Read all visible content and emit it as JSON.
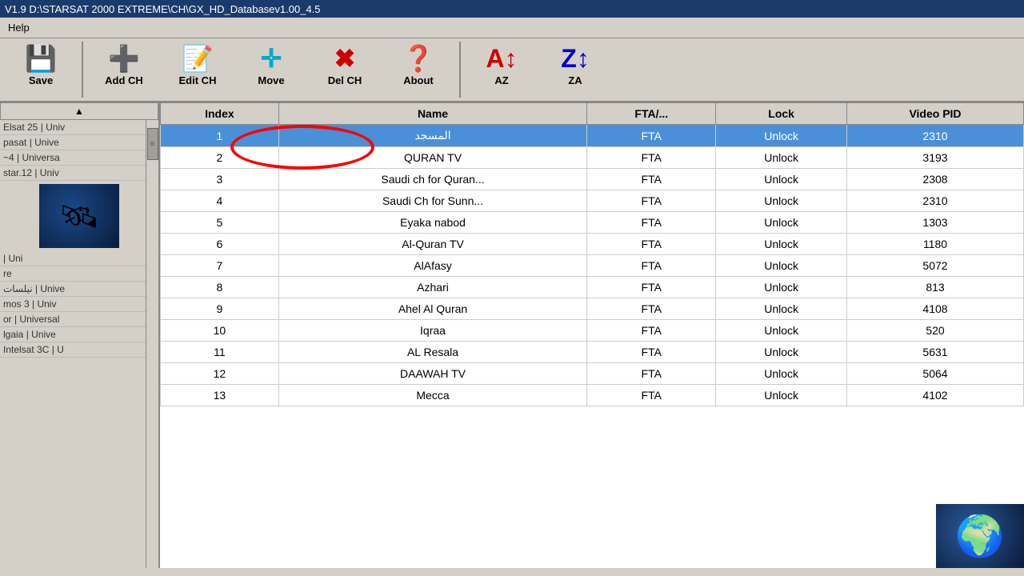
{
  "titleBar": {
    "text": "V1.9 D:\\STARSAT 2000 EXTREME\\CH\\GX_HD_Databasev1.00_4.5"
  },
  "menuBar": {
    "items": [
      "Help"
    ]
  },
  "toolbar": {
    "buttons": [
      {
        "id": "save",
        "label": "Save",
        "icon": "💾",
        "iconClass": "icon-save"
      },
      {
        "id": "add-ch",
        "label": "Add CH",
        "icon": "➕",
        "iconClass": "icon-add"
      },
      {
        "id": "edit-ch",
        "label": "Edit CH",
        "icon": "📝",
        "iconClass": "icon-edit"
      },
      {
        "id": "move",
        "label": "Move",
        "icon": "✛",
        "iconClass": "icon-move"
      },
      {
        "id": "del-ch",
        "label": "Del CH",
        "icon": "✖",
        "iconClass": "icon-del"
      },
      {
        "id": "about",
        "label": "About",
        "icon": "❓",
        "iconClass": "icon-about"
      },
      {
        "id": "az",
        "label": "AZ",
        "icon": "A↕",
        "iconClass": "icon-az"
      },
      {
        "id": "za",
        "label": "ZA",
        "icon": "Z↕",
        "iconClass": "icon-za"
      }
    ]
  },
  "sidebar": {
    "items": [
      "Elsat 25 | Univ",
      "pasat | Unive",
      "~4 | Universa",
      "star.12 | Univ",
      "| Uni",
      "re",
      "نيلسات | Unive",
      "mos 3 | Univ",
      "or | Universal",
      "lgaia | Unive",
      "Intelsat 3C | U"
    ]
  },
  "table": {
    "columns": [
      "Index",
      "Name",
      "FTA/...",
      "Lock",
      "Video PID"
    ],
    "rows": [
      {
        "index": 1,
        "name": "المسجد",
        "fta": "FTA",
        "lock": "Unlock",
        "videoPid": 2310,
        "selected": true
      },
      {
        "index": 2,
        "name": "QURAN TV",
        "fta": "FTA",
        "lock": "Unlock",
        "videoPid": 3193,
        "selected": false
      },
      {
        "index": 3,
        "name": "Saudi ch for Quran...",
        "fta": "FTA",
        "lock": "Unlock",
        "videoPid": 2308,
        "selected": false
      },
      {
        "index": 4,
        "name": "Saudi Ch for Sunn...",
        "fta": "FTA",
        "lock": "Unlock",
        "videoPid": 2310,
        "selected": false
      },
      {
        "index": 5,
        "name": "Eyaka nabod",
        "fta": "FTA",
        "lock": "Unlock",
        "videoPid": 1303,
        "selected": false
      },
      {
        "index": 6,
        "name": "Al-Quran TV",
        "fta": "FTA",
        "lock": "Unlock",
        "videoPid": 1180,
        "selected": false
      },
      {
        "index": 7,
        "name": "AlAfasy",
        "fta": "FTA",
        "lock": "Unlock",
        "videoPid": 5072,
        "selected": false
      },
      {
        "index": 8,
        "name": "Azhari",
        "fta": "FTA",
        "lock": "Unlock",
        "videoPid": 813,
        "selected": false
      },
      {
        "index": 9,
        "name": "Ahel Al Quran",
        "fta": "FTA",
        "lock": "Unlock",
        "videoPid": 4108,
        "selected": false
      },
      {
        "index": 10,
        "name": "Iqraa",
        "fta": "FTA",
        "lock": "Unlock",
        "videoPid": 520,
        "selected": false
      },
      {
        "index": 11,
        "name": "AL Resala",
        "fta": "FTA",
        "lock": "Unlock",
        "videoPid": 5631,
        "selected": false
      },
      {
        "index": 12,
        "name": "DAAWAH TV",
        "fta": "FTA",
        "lock": "Unlock",
        "videoPid": 5064,
        "selected": false
      },
      {
        "index": 13,
        "name": "Mecca",
        "fta": "FTA",
        "lock": "Unlock",
        "videoPid": 4102,
        "selected": false
      }
    ]
  }
}
